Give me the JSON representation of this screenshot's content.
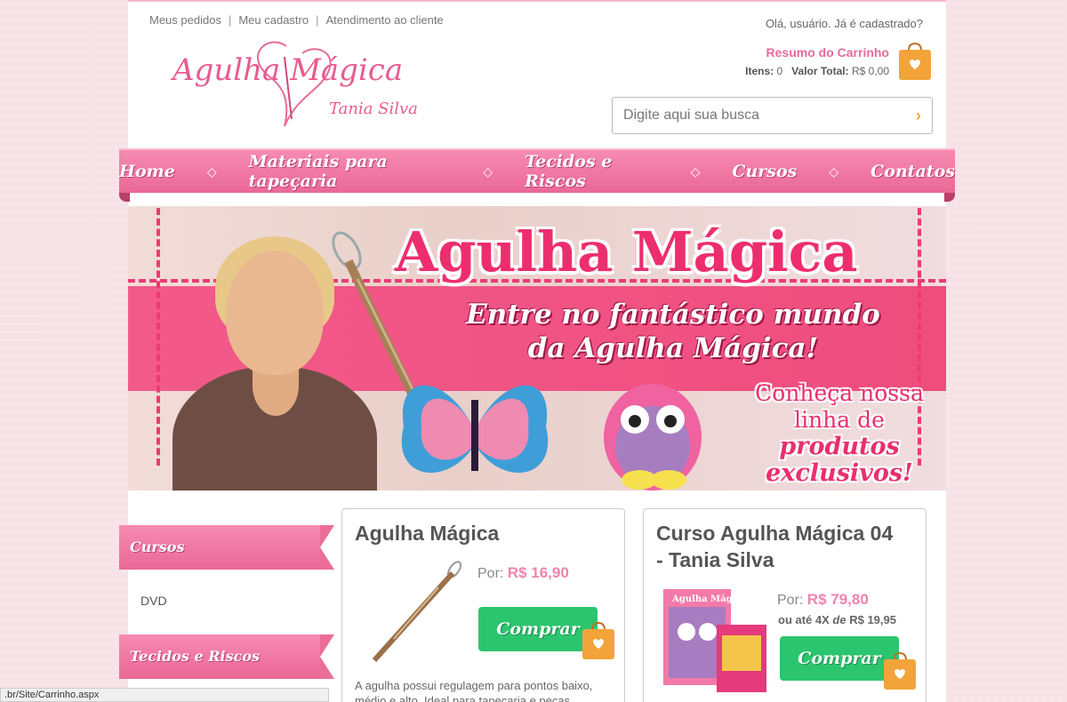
{
  "header": {
    "links": [
      "Meus pedidos",
      "Meu cadastro",
      "Atendimento ao cliente"
    ],
    "greeting": "Olá, usuário. Já é cadastrado?",
    "logo_title": "Agulha Mágica",
    "logo_subtitle": "Tania Silva"
  },
  "cart": {
    "title": "Resumo do Carrinho",
    "items_label": "Itens:",
    "items_value": "0",
    "total_label": "Valor Total:",
    "total_value": "R$ 0,00"
  },
  "search": {
    "placeholder": "Digite aqui sua busca",
    "icon": "chevron-right-icon"
  },
  "nav": {
    "items": [
      "Home",
      "Materiais para tapeçaria",
      "Tecidos e Riscos",
      "Cursos",
      "Contatos"
    ]
  },
  "banner": {
    "title": "Agulha Mágica",
    "subtitle_1": "Entre no fantástico mundo",
    "subtitle_2": "da Agulha Mágica!",
    "cta_1": "Conheça nossa",
    "cta_2": "linha de",
    "cta_3": "produtos",
    "cta_4": "exclusivos!"
  },
  "sidebar": {
    "sections": [
      {
        "title": "Cursos",
        "items": [
          "DVD"
        ]
      },
      {
        "title": "Tecidos e Riscos",
        "items": []
      }
    ]
  },
  "products": [
    {
      "name": "Agulha Mágica",
      "price_label": "Por:",
      "price": "R$ 16,90",
      "buy_label": "Comprar",
      "description": "A agulha possui regulagem para pontos baixo, médio e alto. Ideal para tapeçaria e peças"
    },
    {
      "name_line1": "Curso Agulha Mágica 04",
      "name_line2": "- Tania Silva",
      "price_label": "Por:",
      "price": "R$ 79,80",
      "installment_prefix": "ou até 4X",
      "installment_mid": "de",
      "installment_value": "R$ 19,95",
      "buy_label": "Comprar",
      "box_title": "Agulha Mágica"
    }
  ],
  "statusbar": {
    "url": ".br/Site/Carrinho.aspx"
  },
  "colors": {
    "brand_pink": "#ea6896",
    "buy_green": "#2cc56f",
    "price_pink": "#f082ad",
    "bag_orange": "#f2a43a"
  }
}
